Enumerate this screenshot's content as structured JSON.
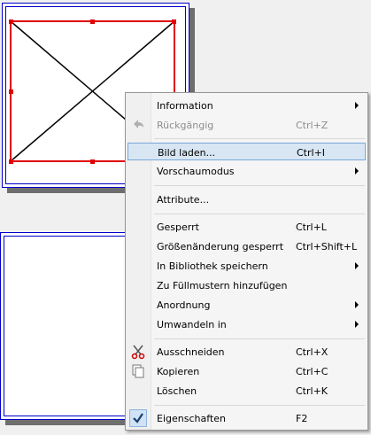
{
  "context_menu": {
    "items": [
      {
        "label": "Information",
        "shortcut": "",
        "submenu": true
      },
      {
        "label": "Rückgängig",
        "shortcut": "Ctrl+Z",
        "disabled": true,
        "icon": "undo-icon"
      },
      {
        "label": "Bild laden...",
        "shortcut": "Ctrl+I",
        "highlighted": true
      },
      {
        "label": "Vorschaumodus",
        "shortcut": "",
        "submenu": true
      },
      {
        "label": "Attribute...",
        "shortcut": ""
      },
      {
        "label": "Gesperrt",
        "shortcut": "Ctrl+L"
      },
      {
        "label": "Größenänderung gesperrt",
        "shortcut": "Ctrl+Shift+L"
      },
      {
        "label": "In Bibliothek speichern",
        "shortcut": "",
        "submenu": true
      },
      {
        "label": "Zu Füllmustern hinzufügen",
        "shortcut": ""
      },
      {
        "label": "Anordnung",
        "shortcut": "",
        "submenu": true
      },
      {
        "label": "Umwandeln in",
        "shortcut": "",
        "submenu": true
      },
      {
        "label": "Ausschneiden",
        "shortcut": "Ctrl+X",
        "icon": "scissors-icon"
      },
      {
        "label": "Kopieren",
        "shortcut": "Ctrl+C",
        "icon": "copy-icon"
      },
      {
        "label": "Löschen",
        "shortcut": "Ctrl+K"
      },
      {
        "label": "Eigenschaften",
        "shortcut": "F2",
        "icon": "checkmark-icon",
        "checked": true
      }
    ]
  },
  "colors": {
    "frame_border": "#0000c8",
    "selection_border": "#e00000",
    "menu_highlight": "#d8e6f3"
  }
}
